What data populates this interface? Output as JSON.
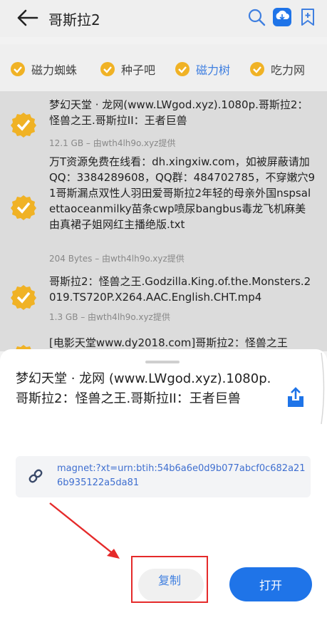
{
  "header": {
    "title": "哥斯拉2"
  },
  "tabs": [
    {
      "label": "磁力蜘蛛"
    },
    {
      "label": "种子吧"
    },
    {
      "label": "磁力树"
    },
    {
      "label": "吃力网"
    }
  ],
  "results": [
    {
      "name": "梦幻天堂 · 龙网(www.LWgod.xyz).1080p.哥斯拉2：怪兽之王.哥斯拉II：王者巨兽",
      "meta": "12.1 GB – 由wth4lh9o.xyz提供"
    },
    {
      "name": "万T资源免费在线看：dh.xingxiw.com，如被屏蔽请加QQ：3384289608，QQ群：484702785，不穿嫩穴91哥斯漏点双性人羽田爱哥斯拉2年轻的母亲外国nspsalettaoceanmilky苗条cwp喷尿bangbus毒龙飞机麻美由真裙子姐网红主播绝版.txt",
      "meta": "204 Bytes – 由wth4lh9o.xyz提供"
    },
    {
      "name": "哥斯拉2：怪兽之王.Godzilla.King.of.the.Monsters.2019.TS720P.X264.AAC.English.CHT.mp4",
      "meta": "1.3 GB – 由wth4lh9o.xyz提供"
    },
    {
      "name": "[电影天堂www.dy2018.com]哥斯拉2：怪兽之王"
    }
  ],
  "sheet": {
    "title": "梦幻天堂 · 龙网 (www.LWgod.xyz).1080p.哥斯拉2：怪兽之王.哥斯拉II：王者巨兽",
    "magnet": "magnet:?xt=urn:btih:54b6a6e0d9b077abcf0c682a216b935122a5da81",
    "copy_label": "复制",
    "open_label": "打开"
  },
  "colors": {
    "accent": "#1f74e8",
    "badge": "#f0b225",
    "annotation": "#e52a2a"
  }
}
